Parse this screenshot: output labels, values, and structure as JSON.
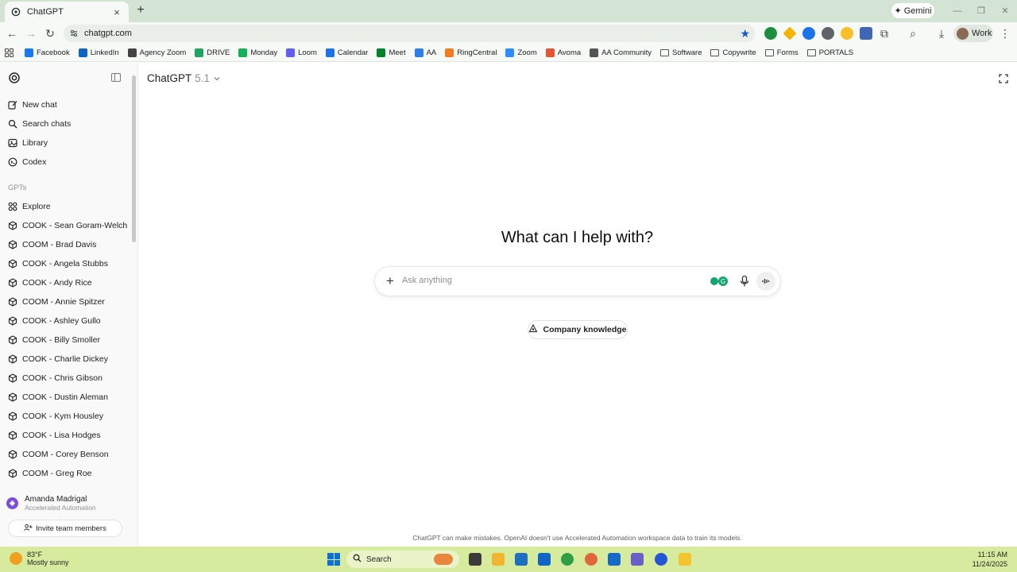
{
  "browser": {
    "tab_title": "ChatGPT",
    "gemini_label": "Gemini",
    "url": "chatgpt.com",
    "profile_label": "Work"
  },
  "bookmarks": [
    {
      "label": "Facebook",
      "icon": "facebook-icon",
      "color": "#1877f2"
    },
    {
      "label": "LinkedIn",
      "icon": "linkedin-icon",
      "color": "#0a66c2"
    },
    {
      "label": "Agency Zoom",
      "icon": "agency-zoom-icon",
      "color": "#444444"
    },
    {
      "label": "DRIVE",
      "icon": "drive-icon",
      "color": "#1fa463"
    },
    {
      "label": "Monday",
      "icon": "monday-icon",
      "color": "#11b35a"
    },
    {
      "label": "Loom",
      "icon": "loom-icon",
      "color": "#625df5"
    },
    {
      "label": "Calendar",
      "icon": "calendar-icon",
      "color": "#1a73e8"
    },
    {
      "label": "Meet",
      "icon": "meet-icon",
      "color": "#00832d"
    },
    {
      "label": "AA",
      "icon": "aa-icon",
      "color": "#2b7de9"
    },
    {
      "label": "RingCentral",
      "icon": "ringcentral-icon",
      "color": "#f47b20"
    },
    {
      "label": "Zoom",
      "icon": "zoom-icon",
      "color": "#2d8cff"
    },
    {
      "label": "Avoma",
      "icon": "avoma-icon",
      "color": "#e8542f"
    },
    {
      "label": "AA Community",
      "icon": "aa-community-icon",
      "color": "#555555"
    },
    {
      "label": "Software",
      "icon": "folder-icon",
      "color": "#555555"
    },
    {
      "label": "Copywrite",
      "icon": "folder-icon",
      "color": "#555555"
    },
    {
      "label": "Forms",
      "icon": "folder-icon",
      "color": "#555555"
    },
    {
      "label": "PORTALS",
      "icon": "folder-icon",
      "color": "#555555"
    }
  ],
  "sidebar": {
    "top_items": [
      {
        "label": "New chat",
        "icon": "new-chat-icon"
      },
      {
        "label": "Search chats",
        "icon": "search-icon"
      },
      {
        "label": "Library",
        "icon": "library-icon"
      },
      {
        "label": "Codex",
        "icon": "codex-icon"
      }
    ],
    "section_label": "GPTs",
    "gpts": [
      "Explore",
      "COOK - Sean Goram-Welch",
      "COOM - Brad Davis",
      "COOK - Angela Stubbs",
      "COOK - Andy Rice",
      "COOM - Annie Spitzer",
      "COOK - Ashley Gullo",
      "COOK - Billy Smoller",
      "COOK - Charlie Dickey",
      "COOK - Chris Gibson",
      "COOK - Dustin Aleman",
      "COOK - Kym Housley",
      "COOK - Lisa Hodges",
      "COOM - Corey Benson",
      "COOM - Greg Roe"
    ],
    "user_name": "Amanda Madrigal",
    "user_org": "Accelerated Automation",
    "invite_label": "Invite team members"
  },
  "main": {
    "model_name": "ChatGPT",
    "model_version": "5.1",
    "hero": "What can I help with?",
    "composer_placeholder": "Ask anything",
    "company_knowledge_label": "Company knowledge",
    "disclaimer": "ChatGPT can make mistakes. OpenAI doesn't use Accelerated Automation workspace data to train its models."
  },
  "taskbar": {
    "weather_temp": "83°F",
    "weather_desc": "Mostly sunny",
    "search_label": "Search",
    "time": "11:15 AM",
    "date": "11/24/2025"
  },
  "colors": {
    "accent_star": "#1a57c9",
    "taskbar_bg": "#d7eb9f",
    "tabstrip_bg": "#d3e3d4"
  }
}
